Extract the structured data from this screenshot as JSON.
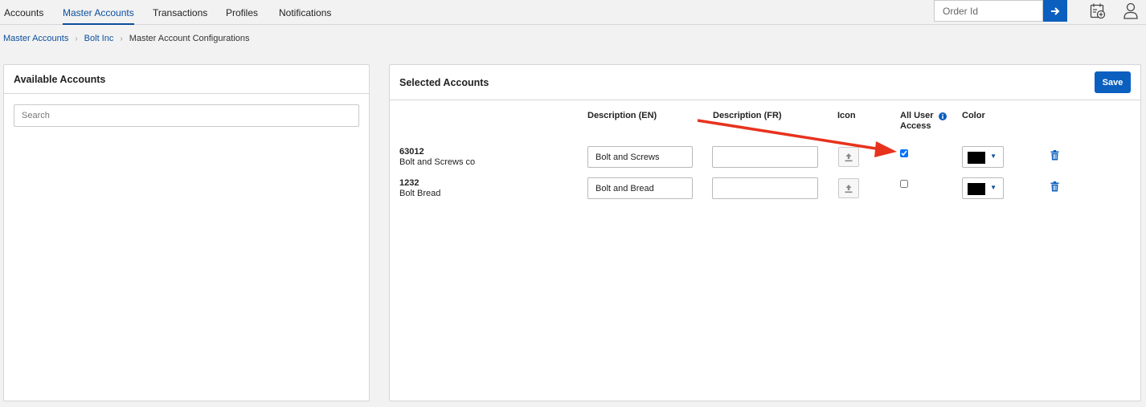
{
  "nav": {
    "tabs": [
      {
        "label": "Accounts"
      },
      {
        "label": "Master Accounts"
      },
      {
        "label": "Transactions"
      },
      {
        "label": "Profiles"
      },
      {
        "label": "Notifications"
      }
    ],
    "active_tab": "Master Accounts",
    "order_placeholder": "Order Id"
  },
  "breadcrumb": {
    "items": [
      "Master Accounts",
      "Bolt Inc"
    ],
    "current": "Master Account Configurations"
  },
  "available": {
    "title": "Available Accounts",
    "search_placeholder": "Search"
  },
  "selected": {
    "title": "Selected Accounts",
    "save_label": "Save",
    "columns": {
      "desc_en": "Description (EN)",
      "desc_fr": "Description (FR)",
      "icon": "Icon",
      "all_user_access_1": "All User",
      "all_user_access_2": "Access",
      "color": "Color"
    },
    "rows": [
      {
        "number": "63012",
        "name": "Bolt and Screws co",
        "desc_en": "Bolt and Screws",
        "desc_fr": "",
        "all_user_access": true,
        "color": "#000000"
      },
      {
        "number": "1232",
        "name": "Bolt Bread",
        "desc_en": "Bolt and Bread",
        "desc_fr": "",
        "all_user_access": false,
        "color": "#000000"
      }
    ]
  },
  "colors": {
    "accent": "#0b5fbf",
    "link": "#0b4f9c",
    "annotation_arrow": "#e8321e"
  }
}
